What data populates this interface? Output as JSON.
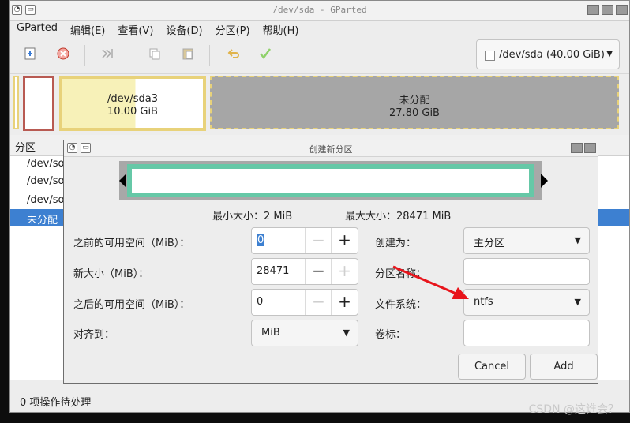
{
  "window": {
    "title": "/dev/sda - GParted"
  },
  "menubar": {
    "items": [
      "GParted",
      "编辑(E)",
      "查看(V)",
      "设备(D)",
      "分区(P)",
      "帮助(H)"
    ]
  },
  "toolbar": {
    "icons": [
      "new-partition-icon",
      "delete-icon",
      "resize-move-icon",
      "copy-icon",
      "paste-icon",
      "undo-icon",
      "apply-icon"
    ],
    "device_label": "/dev/sda (40.00 GiB)"
  },
  "partition_map": {
    "sda3": {
      "name": "/dev/sda3",
      "size": "10.00 GiB"
    },
    "unallocated": {
      "name": "未分配",
      "size": "27.80 GiB"
    }
  },
  "partition_list": {
    "header_partition": "分区",
    "rows": [
      "/dev/so",
      "/dev/so",
      "/dev/so",
      "未分配"
    ]
  },
  "status": {
    "text": "0 项操作待处理"
  },
  "dialog": {
    "title": "创建新分区",
    "min_size": "最小大小：2 MiB",
    "max_size": "最大大小：28471 MiB",
    "labels": {
      "free_before": "之前的可用空间（MiB）：",
      "new_size": "新大小（MiB）：",
      "free_after": "之后的可用空间（MiB）：",
      "align_to": "对齐到：",
      "create_as": "创建为：",
      "partition_name": "分区名称：",
      "file_system": "文件系统：",
      "label": "卷标："
    },
    "values": {
      "free_before": "0",
      "new_size": "28471",
      "free_after": "0",
      "align_to": "MiB",
      "create_as": "主分区",
      "partition_name": "",
      "file_system": "ntfs",
      "label": ""
    },
    "buttons": {
      "cancel": "Cancel",
      "add": "Add"
    }
  },
  "annotation": {
    "arrow_color": "#e8141b"
  },
  "watermark": "CSDN @这谁会？"
}
